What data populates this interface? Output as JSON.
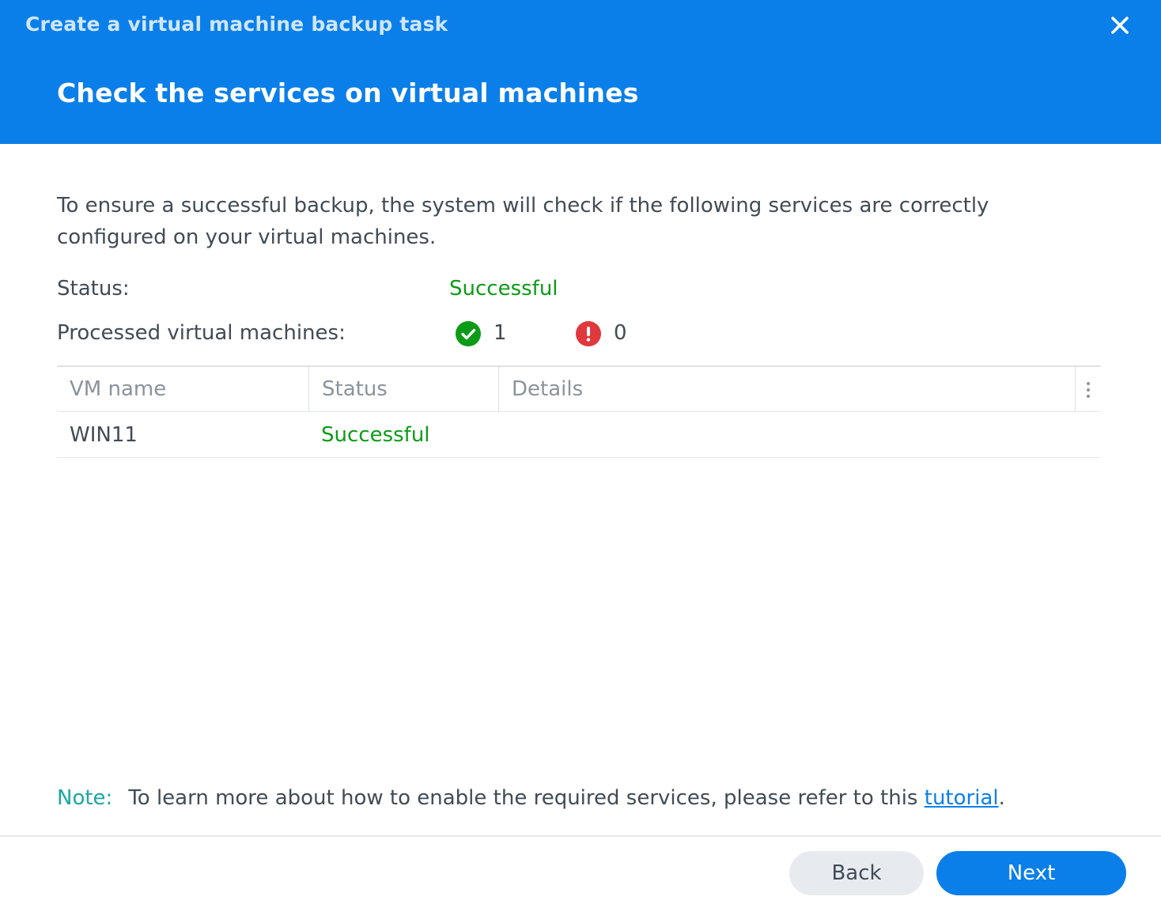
{
  "dialog": {
    "title": "Create a virtual machine backup task",
    "step_title": "Check the services on virtual machines"
  },
  "description": "To ensure a successful backup, the system will check if the following services are correctly configured on your virtual machines.",
  "summary": {
    "status_label": "Status:",
    "status_value": "Successful",
    "processed_label": "Processed virtual machines:",
    "success_count": "1",
    "error_count": "0"
  },
  "table": {
    "headers": [
      "VM name",
      "Status",
      "Details"
    ],
    "rows": [
      {
        "vm_name": "WIN11",
        "status": "Successful",
        "details": ""
      }
    ]
  },
  "note": {
    "label": "Note:",
    "text": "To learn more about how to enable the required services, please refer to this ",
    "link_text": "tutorial",
    "suffix": "."
  },
  "buttons": {
    "back": "Back",
    "next": "Next"
  },
  "colors": {
    "header_bg": "#0b7fe9",
    "success": "#0c9b17",
    "error": "#e0383d",
    "note_label": "#19a7a1",
    "link": "#0b7fe9"
  },
  "icons": {
    "close": "close-icon",
    "success": "check-circle-icon",
    "error": "exclamation-circle-icon",
    "column_menu": "vertical-dots-icon"
  }
}
